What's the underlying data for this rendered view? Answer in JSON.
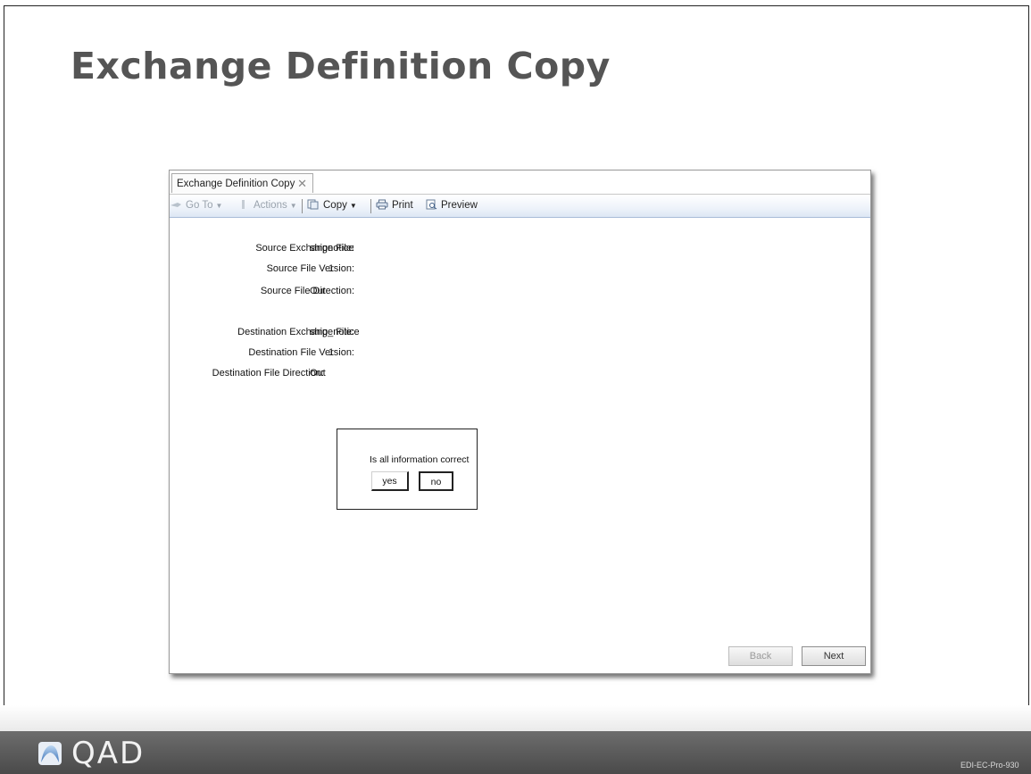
{
  "slide": {
    "title": "Exchange Definition Copy",
    "code": "EDI-EC-Pro-930",
    "brand": "QAD"
  },
  "window": {
    "tab_label": "Exchange Definition Copy",
    "toolbar": {
      "goto_label": "Go To",
      "actions_label": "Actions",
      "copy_label": "Copy",
      "print_label": "Print",
      "preview_label": "Preview"
    }
  },
  "form": {
    "source_exchange_file_label": "Source Exchange File:",
    "source_exchange_file_value": "shipnotice",
    "source_file_version_label": "Source File Version:",
    "source_file_version_value": "1",
    "source_file_direction_label": "Source File Direction:",
    "source_file_direction_value": "Out",
    "dest_exchange_file_label": "Destination Exchange File:",
    "dest_exchange_file_value": "ship_notice",
    "dest_file_version_label": "Destination File Version:",
    "dest_file_version_value": "1",
    "dest_file_direction_label": "Destination File Direction:",
    "dest_file_direction_value": "Out"
  },
  "dialog": {
    "prompt": "Is all information correct",
    "yes_label": "yes",
    "no_label": "no"
  },
  "nav": {
    "back_label": "Back",
    "next_label": "Next"
  },
  "colors": {
    "title": "#555555",
    "footer": "#555555",
    "toolbar_accent": "#a8bcd8"
  }
}
